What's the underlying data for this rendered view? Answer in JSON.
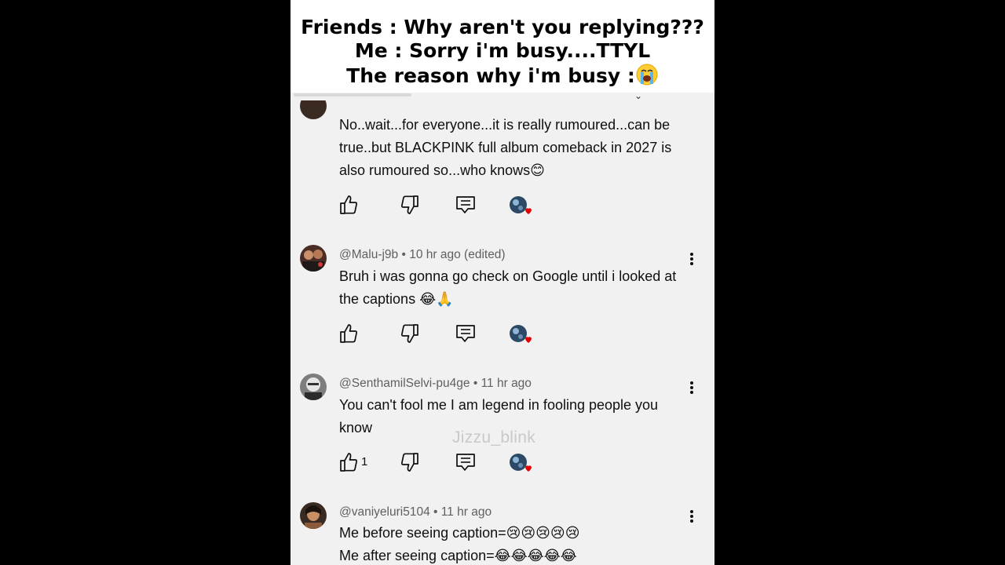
{
  "caption": {
    "line1": "Friends : Why aren't you replying???",
    "line2": "Me : Sorry i'm busy....TTYL",
    "line3": "The reason why i'm busy :"
  },
  "comments": [
    {
      "handle": "",
      "time": "",
      "body": "No..wait...for everyone...it is really rumoured...can be true..but BLACKPINK full album comeback in 2027 is also rumoured so...who knows😊",
      "likes": ""
    },
    {
      "handle": "@Malu-j9b",
      "time": "10 hr ago (edited)",
      "body": "Bruh i was gonna go check on Google until i looked at the captions 😂🙏",
      "likes": ""
    },
    {
      "handle": "@SenthamilSelvi-pu4ge",
      "time": "11 hr ago",
      "body": "You can't fool me I am legend in fooling people you know",
      "likes": "1"
    },
    {
      "handle": "@vaniyeluri5104",
      "time": "11 hr ago",
      "body_line1": "Me before seeing caption=😢😢😢😢😢",
      "body_line2": "Me after seeing caption=😂😂😂😂😂"
    }
  ],
  "meta_separator": " • ",
  "watermark": "Jizzu_blink",
  "icons": [
    "like-icon",
    "dislike-icon",
    "reply-icon",
    "creator-heart-icon",
    "more-vert-icon",
    "crying-emoji-icon"
  ],
  "colors": {
    "background": "#f1f1f1",
    "text": "#0f0f0f",
    "meta": "#606060",
    "heart": "#e00000"
  }
}
